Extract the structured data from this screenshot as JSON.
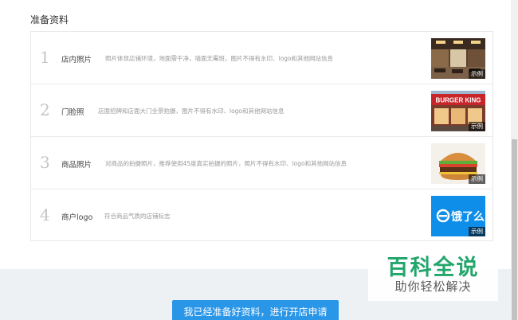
{
  "section": {
    "title": "准备资料"
  },
  "items": [
    {
      "number": "1",
      "name": "店内照片",
      "description": "照片体现店铺环境，地面需干净，墙面无霉斑，图片不得有水印、logo和其他网站信息",
      "example_label": "示例",
      "example_icon": "restaurant-interior-photo"
    },
    {
      "number": "2",
      "name": "门脸照",
      "description": "店面招牌和店面大门全景拍摄，图片不得有水印、logo和其他网站信息",
      "example_label": "示例",
      "example_icon": "burger-king-storefront-photo",
      "sign_text": "BURGER KING"
    },
    {
      "number": "3",
      "name": "商品照片",
      "description": "对商品的拍摄照片，推荐使用45度真实拍摄的照片，照片不得有水印、logo和其他网站信息",
      "example_label": "示例",
      "example_icon": "burger-photo"
    },
    {
      "number": "4",
      "name": "商户logo",
      "description": "符合商品气质的店铺标志",
      "example_label": "示例",
      "example_icon": "eleme-logo",
      "logo_text": "饿了么"
    }
  ],
  "footer": {
    "submit_label": "我已经准备好资料，进行开店申请"
  },
  "watermark": {
    "title": "百科全说",
    "subtitle": "助你轻松解决"
  },
  "colors": {
    "accent": "#2a96e8",
    "watermark_green": "#1aa366",
    "eleme_blue": "#0f8ee9"
  }
}
